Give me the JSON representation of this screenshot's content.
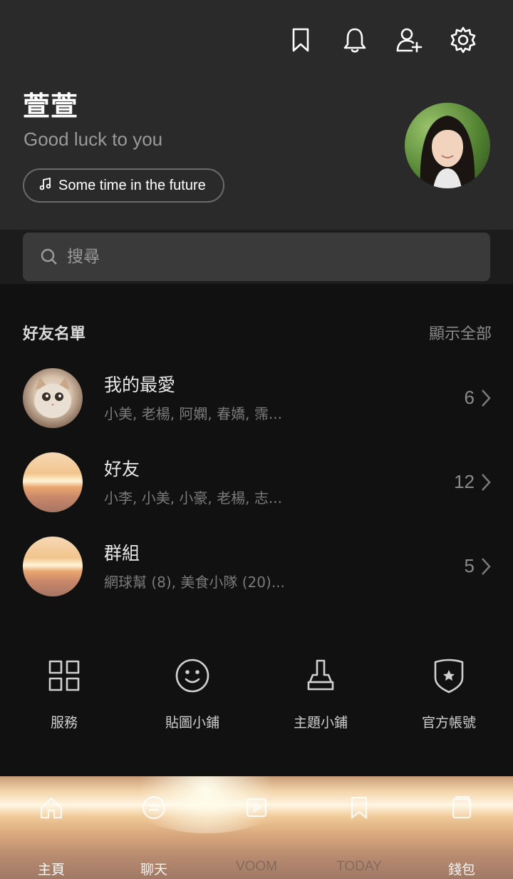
{
  "header": {
    "icons": [
      "bookmark-icon",
      "bell-icon",
      "add-friend-icon",
      "settings-icon"
    ],
    "profile_name": "萱萱",
    "status_message": "Good luck to you",
    "music": "Some time in the future"
  },
  "search": {
    "placeholder": "搜尋"
  },
  "friends_section": {
    "title": "好友名單",
    "show_all": "顯示全部",
    "rows": [
      {
        "title": "我的最愛",
        "subtitle": "小美, 老楊, 阿嫻, 春嬌, 霈...",
        "count": "6"
      },
      {
        "title": "好友",
        "subtitle": "小李, 小美, 小豪, 老楊, 志...",
        "count": "12"
      },
      {
        "title": "群組",
        "subtitle": "網球幫 (8), 美食小隊 (20)...",
        "count": "5"
      }
    ]
  },
  "shortcuts": [
    {
      "label": "服務",
      "icon": "grid-icon"
    },
    {
      "label": "貼圖小鋪",
      "icon": "smiley-icon"
    },
    {
      "label": "主題小鋪",
      "icon": "brush-icon"
    },
    {
      "label": "官方帳號",
      "icon": "shield-star-icon"
    }
  ],
  "tabbar": {
    "tabs": [
      {
        "label": "主頁",
        "icon": "home-icon",
        "active": true
      },
      {
        "label": "聊天",
        "icon": "chat-icon",
        "active": false
      },
      {
        "label": "VOOM",
        "icon": "voom-icon",
        "active": false
      },
      {
        "label": "TODAY",
        "icon": "today-icon",
        "active": false
      },
      {
        "label": "錢包",
        "icon": "wallet-icon",
        "active": false
      }
    ]
  }
}
